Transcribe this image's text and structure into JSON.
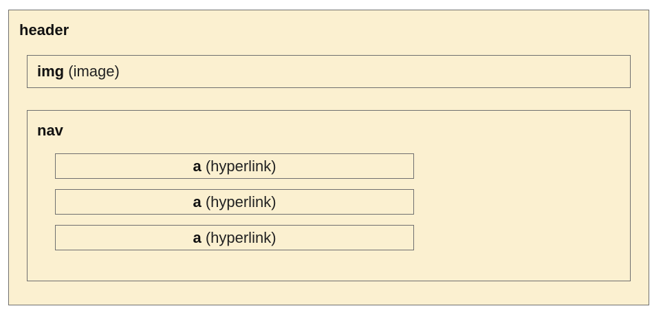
{
  "header": {
    "tag": "header",
    "img": {
      "tag": "img",
      "desc": "(image)"
    },
    "nav": {
      "tag": "nav",
      "links": [
        {
          "tag": "a",
          "desc": "(hyperlink)"
        },
        {
          "tag": "a",
          "desc": "(hyperlink)"
        },
        {
          "tag": "a",
          "desc": "(hyperlink)"
        }
      ]
    }
  },
  "colors": {
    "box_fill": "#fbf0d0",
    "box_border": "#6e6e6e"
  }
}
